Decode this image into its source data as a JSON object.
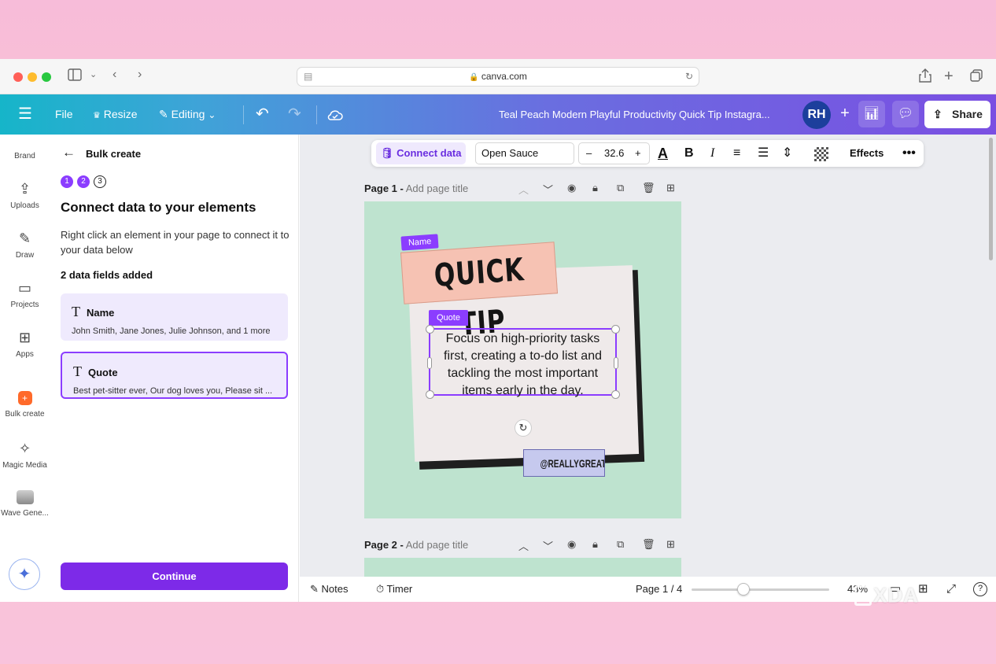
{
  "browser": {
    "url": "canva.com",
    "colors": {
      "close": "#ff5f57",
      "minimize": "#febc2e",
      "zoom": "#28c840"
    }
  },
  "topbar": {
    "file": "File",
    "resize": "Resize",
    "editing": "Editing",
    "doc_title": "Teal Peach Modern Playful Productivity Quick Tip Instagra...",
    "avatar_initials": "RH",
    "share": "Share"
  },
  "rail": {
    "items": [
      {
        "label": "Brand",
        "icon": "crown-icon"
      },
      {
        "label": "Uploads",
        "icon": "cloud-upload-icon"
      },
      {
        "label": "Draw",
        "icon": "pen-icon"
      },
      {
        "label": "Projects",
        "icon": "folder-icon"
      },
      {
        "label": "Apps",
        "icon": "apps-icon"
      },
      {
        "label": "Bulk create",
        "icon": "bulk-create-icon"
      },
      {
        "label": "Magic Media",
        "icon": "magic-media-icon"
      },
      {
        "label": "Wave Gene...",
        "icon": "wave-icon"
      }
    ]
  },
  "panel": {
    "title": "Bulk create",
    "steps": [
      "1",
      "2",
      "3"
    ],
    "heading": "Connect data to your elements",
    "instructions": "Right click an element in your page to connect it to your data below",
    "fields_count": "2 data fields added",
    "fields": [
      {
        "name": "Name",
        "values": "John Smith, Jane Jones, Julie Johnson, and 1 more"
      },
      {
        "name": "Quote",
        "values": "Best pet-sitter ever, Our dog loves you, Please sit ..."
      }
    ],
    "continue": "Continue"
  },
  "toolbar": {
    "connect_data": "Connect data",
    "font": "Open Sauce",
    "font_size": "32.6",
    "effects": "Effects"
  },
  "pages": [
    {
      "label": "Page 1 -",
      "placeholder": "Add page title"
    },
    {
      "label": "Page 2 -",
      "placeholder": "Add page title"
    }
  ],
  "design": {
    "name_tag": "Name",
    "headline": "QUICK TIP",
    "quote_tag": "Quote",
    "quote_text": "Focus on high-priority tasks first, creating a to-do list and tackling the most important items early in the day.",
    "handle": "@REALLYGREATSITE",
    "colors": {
      "background": "#bee3cf",
      "card": "#efeaea",
      "headline_bg": "#f6c2b3",
      "accent": "#8b3dff"
    }
  },
  "bottombar": {
    "notes": "Notes",
    "timer": "Timer",
    "page_indicator": "Page 1 / 4",
    "zoom": "43%"
  },
  "watermark": "XDA"
}
